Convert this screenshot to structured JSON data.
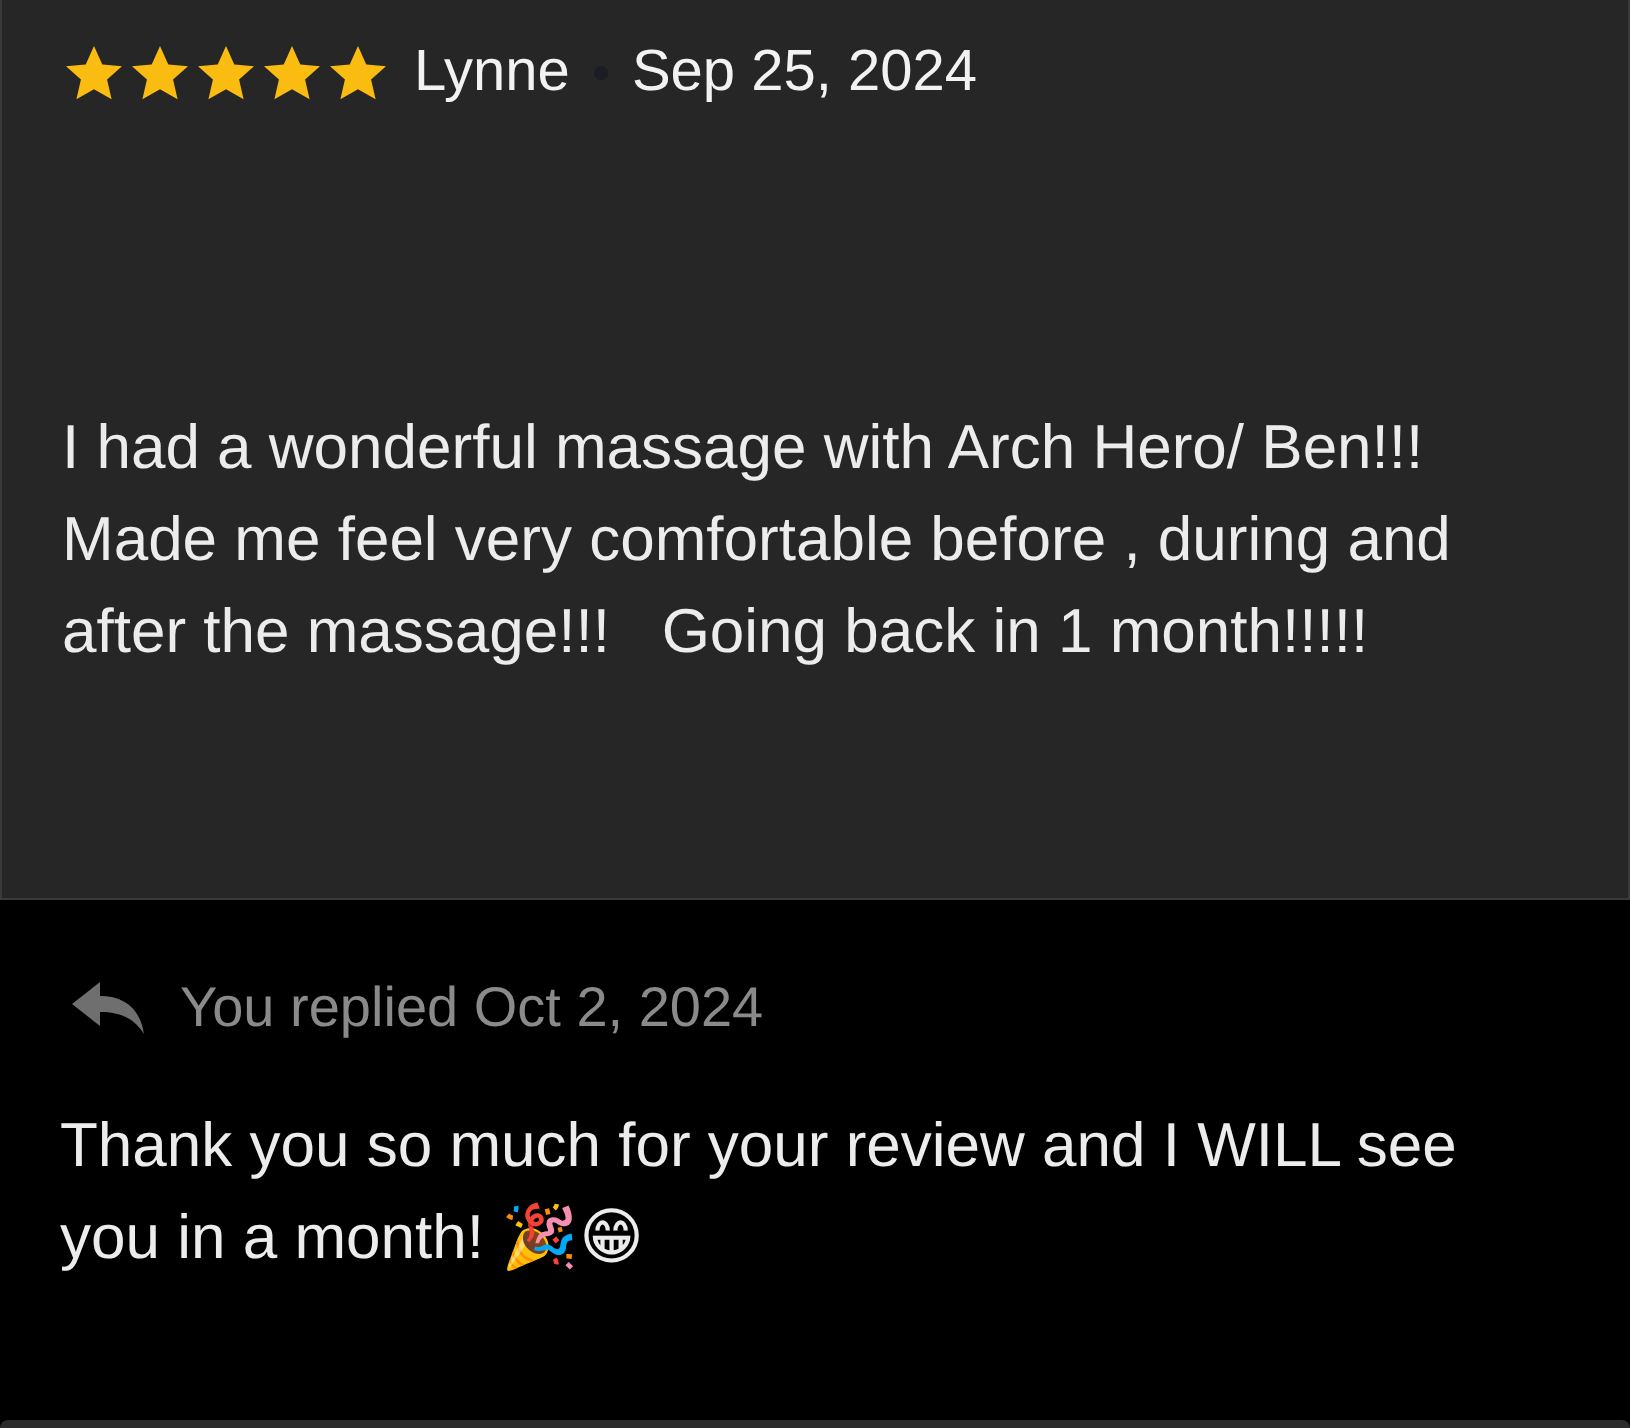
{
  "review": {
    "stars": 5,
    "author": "Lynne",
    "date": "Sep 25, 2024",
    "text": "I had a wonderful massage with Arch Hero/ Ben!!!   Made me feel very comfortable before , during and after the massage!!!   Going back in 1 month!!!!!"
  },
  "reply": {
    "label": "You replied Oct 2, 2024",
    "text": "Thank you so much for your review and I WILL see you in a month! 🎉😁"
  }
}
